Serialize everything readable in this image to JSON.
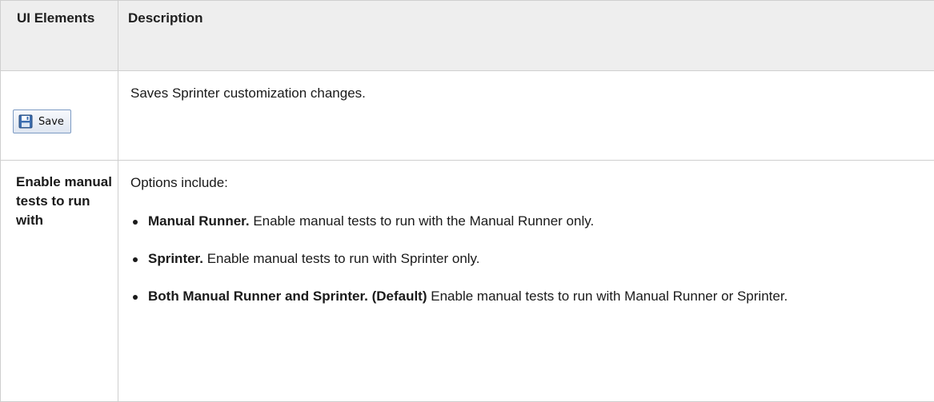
{
  "table": {
    "headers": [
      "UI Elements",
      "Description"
    ],
    "save_row": {
      "button_label": "Save",
      "button_icon": "floppy-disk-icon",
      "description": "Saves Sprinter customization changes."
    },
    "enable_row": {
      "ui_label": "Enable manual tests to run with",
      "intro": "Options include:",
      "options": [
        {
          "name": "Manual Runner.",
          "text": "Enable manual tests to run with the Manual Runner only."
        },
        {
          "name": "Sprinter.",
          "text": "Enable manual tests to run with Sprinter only."
        },
        {
          "name": "Both Manual Runner and Sprinter. (Default)",
          "text": "Enable manual tests to run with Manual Runner or Sprinter."
        }
      ]
    }
  }
}
